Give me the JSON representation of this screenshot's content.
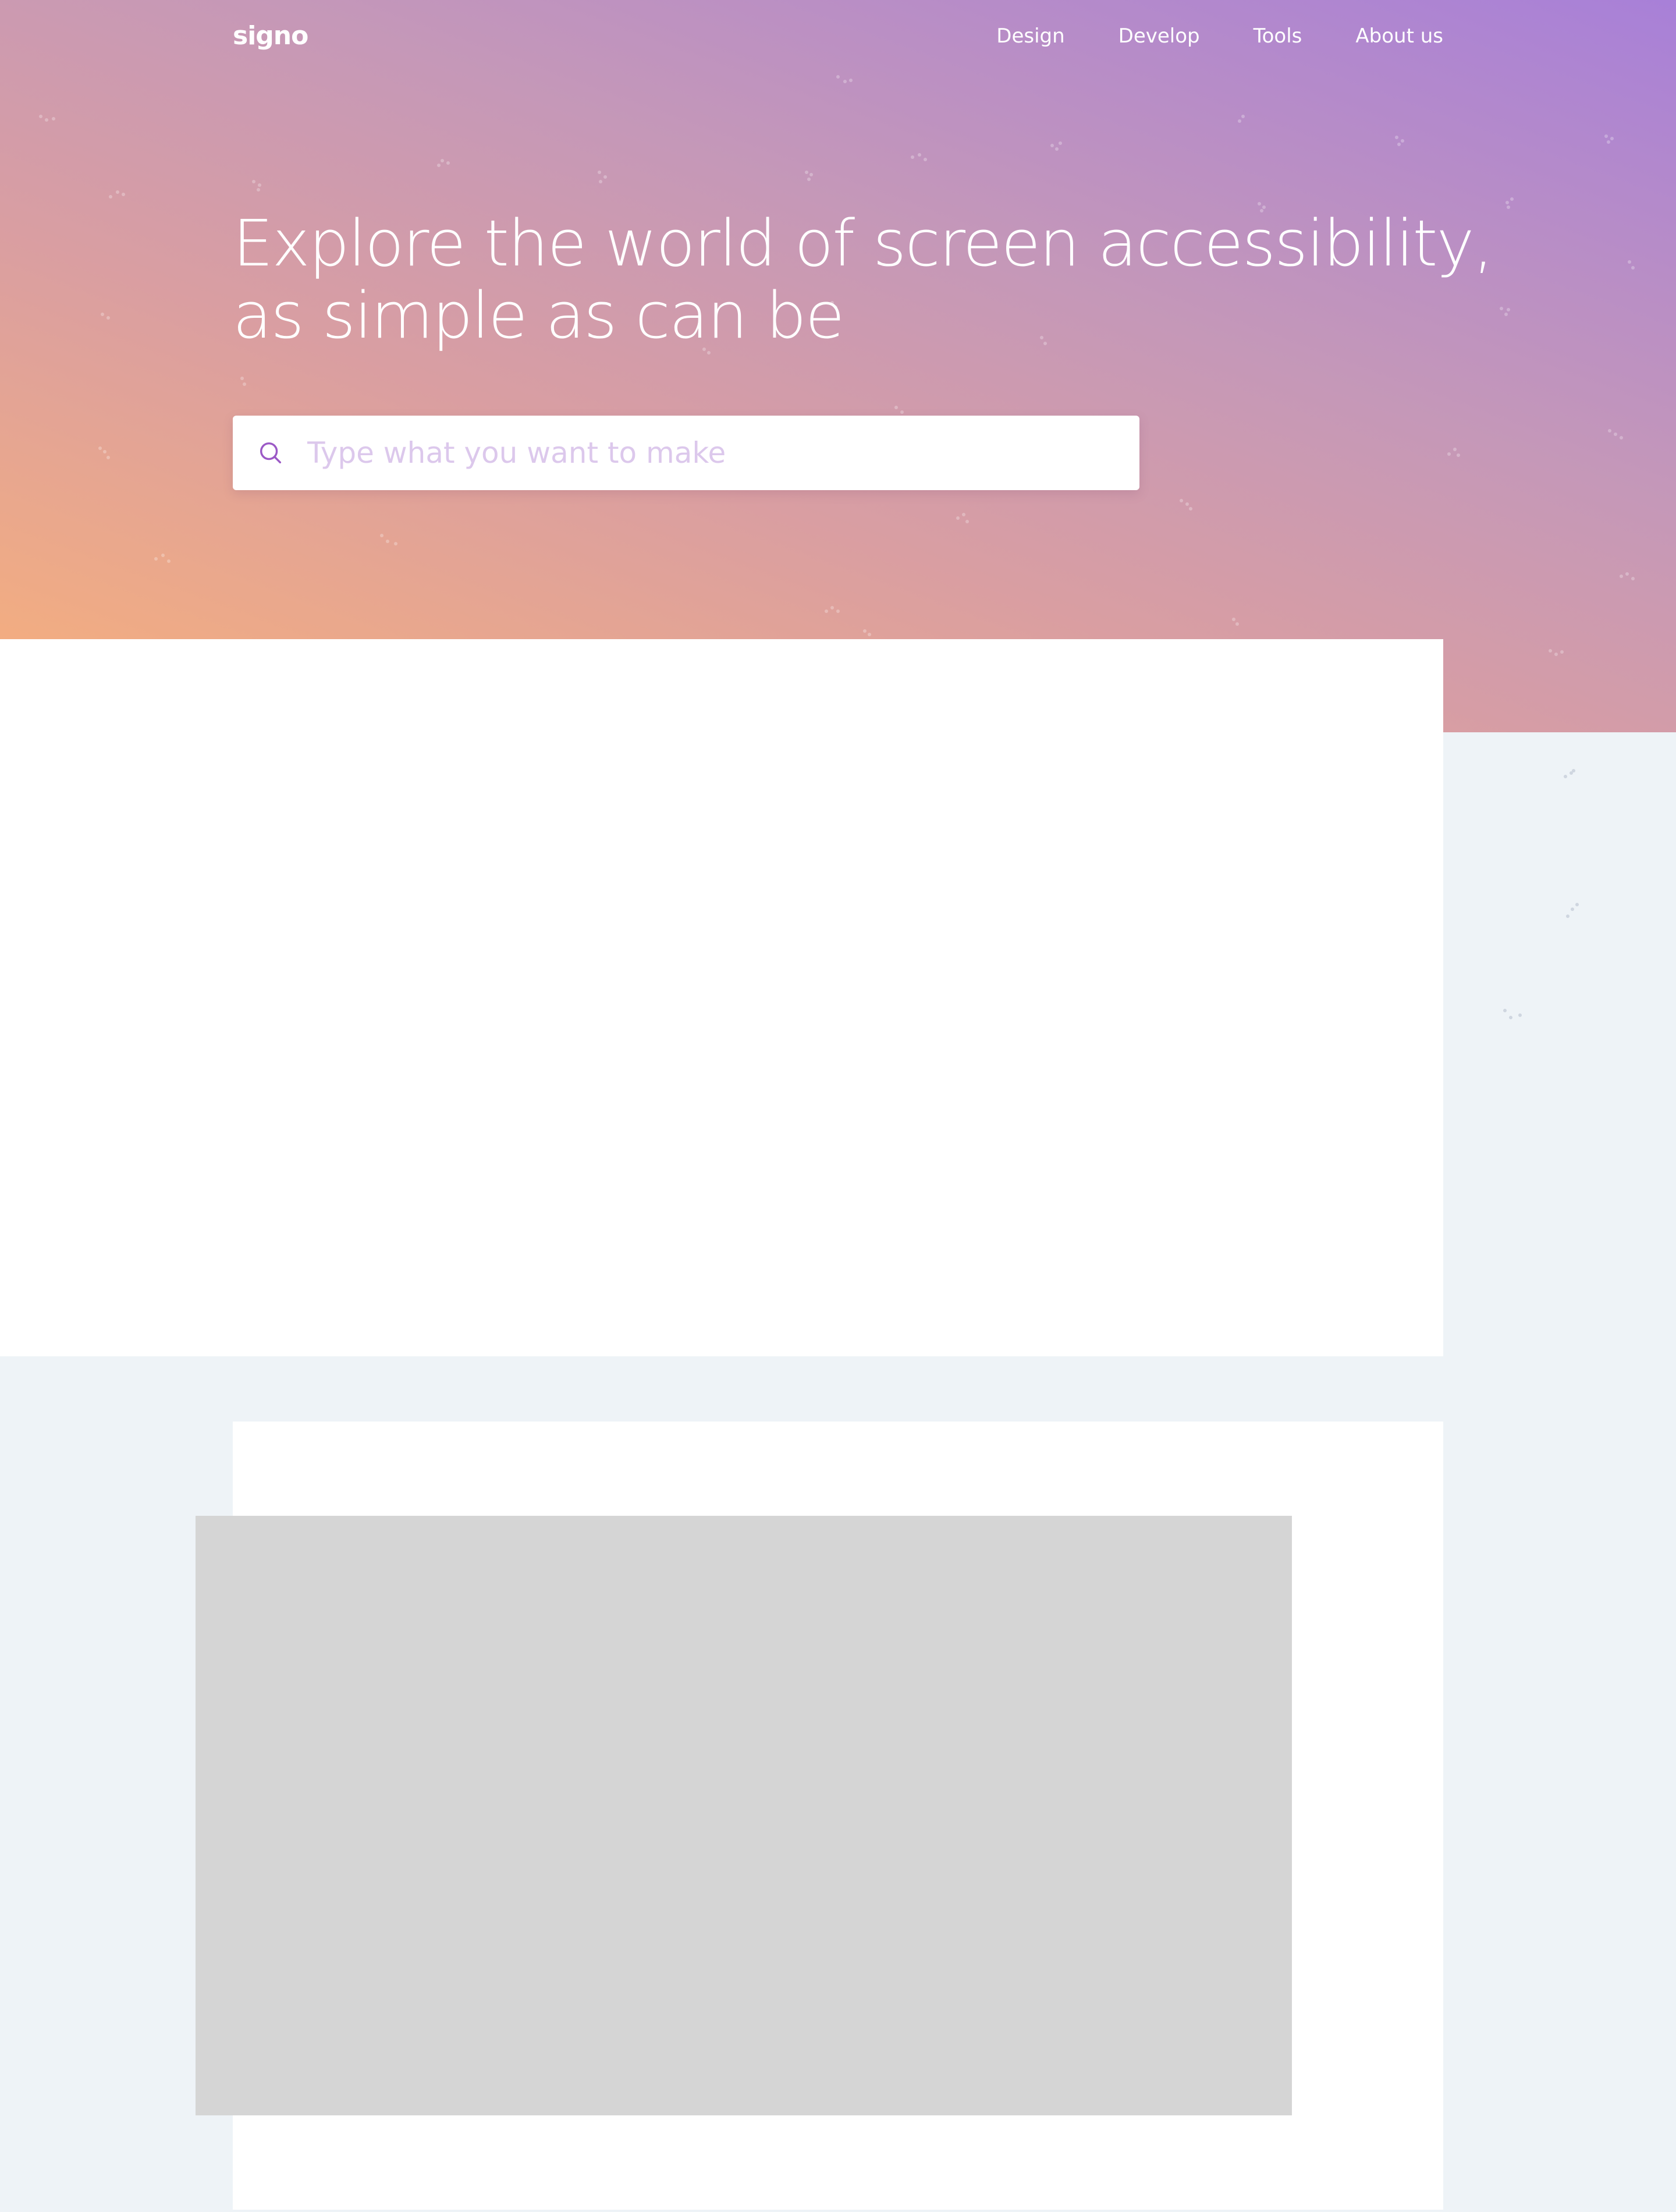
{
  "brand": {
    "logo_text": "signo"
  },
  "nav": {
    "items": [
      {
        "label": "Design"
      },
      {
        "label": "Develop"
      },
      {
        "label": "Tools"
      },
      {
        "label": "About us"
      }
    ]
  },
  "hero": {
    "headline_line1": "Explore the world of screen accessibility,",
    "headline_line2": "as simple as can be"
  },
  "search": {
    "placeholder": "Type what you want to make",
    "value": ""
  },
  "colors": {
    "gradient_start": "#f8b07a",
    "gradient_end": "#a880d8",
    "page_background": "#eef3f7",
    "card_background": "#ffffff",
    "placeholder_text": "#dcc8ec",
    "icon_purple": "#9b59c6",
    "media_placeholder": "#d5d5d5"
  },
  "icons": {
    "search": "search-icon"
  }
}
